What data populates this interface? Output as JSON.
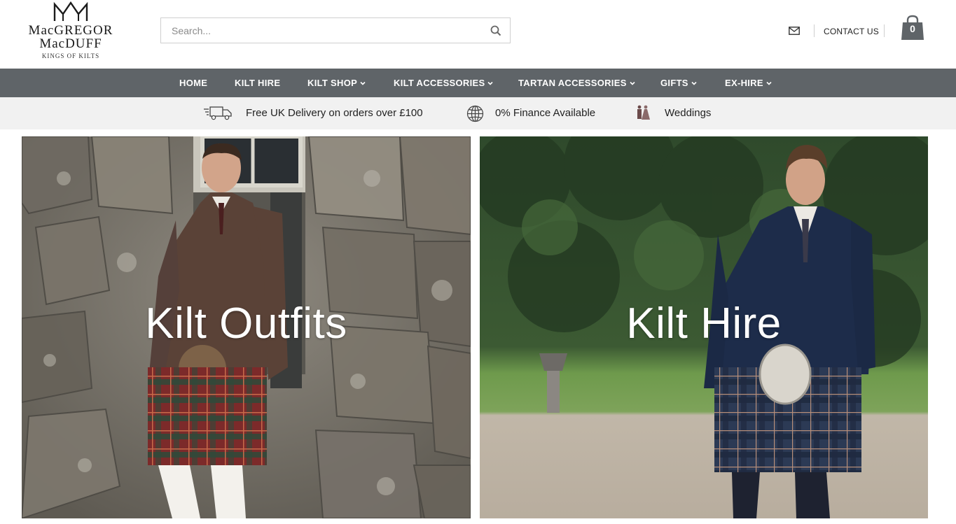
{
  "brand": {
    "line1": "MacGREGOR",
    "line2": "MacDUFF",
    "tagline": "KINGS OF KILTS"
  },
  "search": {
    "placeholder": "Search..."
  },
  "header": {
    "contact_label": "CONTACT US",
    "cart_count": "0"
  },
  "nav": {
    "items": [
      {
        "label": "HOME",
        "dropdown": false
      },
      {
        "label": "KILT HIRE",
        "dropdown": false
      },
      {
        "label": "KILT SHOP",
        "dropdown": true
      },
      {
        "label": "KILT ACCESSORIES",
        "dropdown": true
      },
      {
        "label": "TARTAN ACCESSORIES",
        "dropdown": true
      },
      {
        "label": "GIFTS",
        "dropdown": true
      },
      {
        "label": "EX-HIRE",
        "dropdown": true
      }
    ]
  },
  "info_bar": {
    "items": [
      {
        "icon": "delivery-truck-icon",
        "text": "Free UK Delivery on orders over £100"
      },
      {
        "icon": "globe-icon",
        "text": "0% Finance Available"
      },
      {
        "icon": "wedding-couple-icon",
        "text": "Weddings"
      }
    ]
  },
  "tiles": [
    {
      "caption": "Kilt Outfits"
    },
    {
      "caption": "Kilt Hire"
    }
  ],
  "colors": {
    "nav_bg": "#5f6468",
    "info_bg": "#f1f1f1",
    "cart_bg": "#5f6468"
  }
}
